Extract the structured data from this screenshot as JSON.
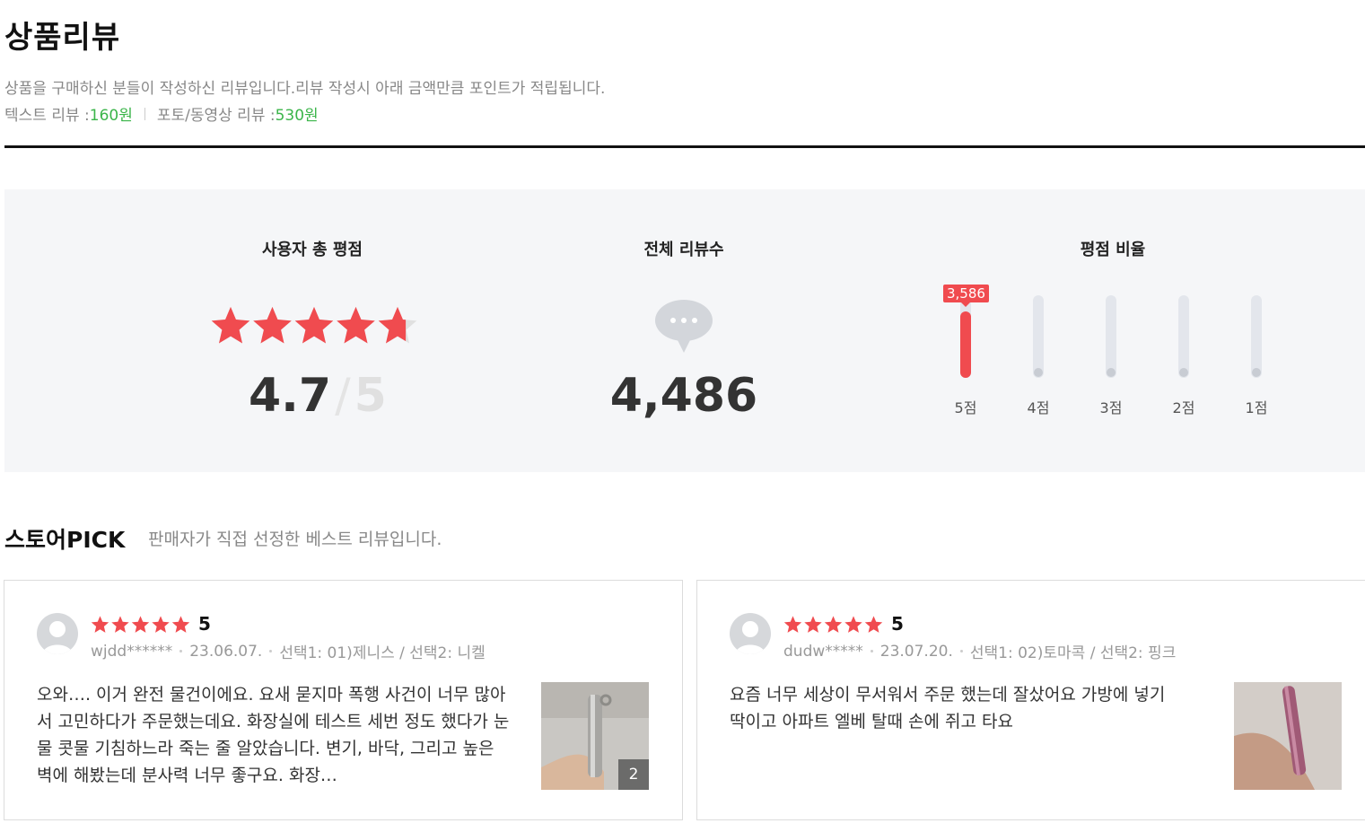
{
  "header": {
    "title": "상품리뷰",
    "description": "상품을 구매하신 분들이 작성하신 리뷰입니다.리뷰 작성시 아래 금액만큼 포인트가 적립됩니다.",
    "text_review_label": "텍스트 리뷰 : ",
    "text_review_point": "160원",
    "photo_review_label": "포토/동영상 리뷰 : ",
    "photo_review_point": "530원"
  },
  "summary": {
    "rating_title": "사용자 총 평점",
    "rating_value": "4.7",
    "rating_slash": "/",
    "rating_max": "5",
    "rating_fraction": 0.94,
    "review_count_title": "전체 리뷰수",
    "review_count": "4,486",
    "distribution_title": "평점 비율",
    "distribution": [
      {
        "label": "5점",
        "count": "3,586",
        "fraction": 0.8
      },
      {
        "label": "4점",
        "fraction": 0
      },
      {
        "label": "3점",
        "fraction": 0
      },
      {
        "label": "2점",
        "fraction": 0
      },
      {
        "label": "1점",
        "fraction": 0
      }
    ]
  },
  "pick": {
    "title": "스토어PICK",
    "description": "판매자가 직접 선정한 베스트 리뷰입니다."
  },
  "reviews": [
    {
      "rating": "5",
      "user": "wjdd******",
      "date": "23.06.07.",
      "option": "선택1: 01)제니스 / 선택2: 니켈",
      "text": "오와…. 이거 완전 물건이에요. 요새 묻지마 폭행 사건이 너무 많아서 고민하다가 주문했는데요. 화장실에 테스트 세번 정도 했다가 눈물 콧물 기침하느라 죽는 줄 알았습니다. 변기, 바닥, 그리고 높은 벽에 해봤는데 분사력 너무 좋구요. 화장…",
      "photo_count": "2"
    },
    {
      "rating": "5",
      "user": "dudw*****",
      "date": "23.07.20.",
      "option": "선택1: 02)토마콕 / 선택2: 핑크",
      "text": "요즘 너무 세상이 무서워서 주문 했는데 잘샀어요 가방에 넣기 딱이고 아파트 엘베 탈때 손에 쥐고 타요"
    }
  ],
  "colors": {
    "accent_red": "#f04b4f",
    "point_green": "#3bb54a"
  }
}
